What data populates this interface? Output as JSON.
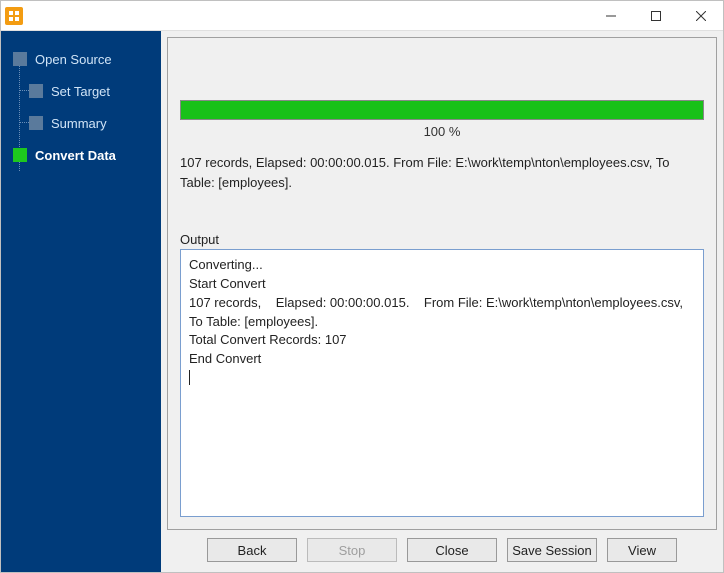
{
  "titlebar": {
    "app_title": ""
  },
  "sidebar": {
    "items": [
      {
        "label": "Open Source",
        "active": false,
        "child": false
      },
      {
        "label": "Set Target",
        "active": false,
        "child": true
      },
      {
        "label": "Summary",
        "active": false,
        "child": true
      },
      {
        "label": "Convert Data",
        "active": true,
        "child": false
      }
    ]
  },
  "progress": {
    "percent_text": "100 %",
    "fill_percent": 100
  },
  "status": {
    "text": "107 records,    Elapsed: 00:00:00.015.    From File: E:\\work\\temp\\nton\\employees.csv,    To Table: [employees]."
  },
  "output": {
    "label": "Output",
    "lines": [
      "Converting...",
      "Start Convert",
      "107 records,    Elapsed: 00:00:00.015.    From File: E:\\work\\temp\\nton\\employees.csv,   To Table: [employees].",
      "Total Convert Records: 107",
      "End Convert"
    ]
  },
  "buttons": {
    "back": "Back",
    "stop": "Stop",
    "close": "Close",
    "save_session": "Save Session",
    "view": "View"
  }
}
